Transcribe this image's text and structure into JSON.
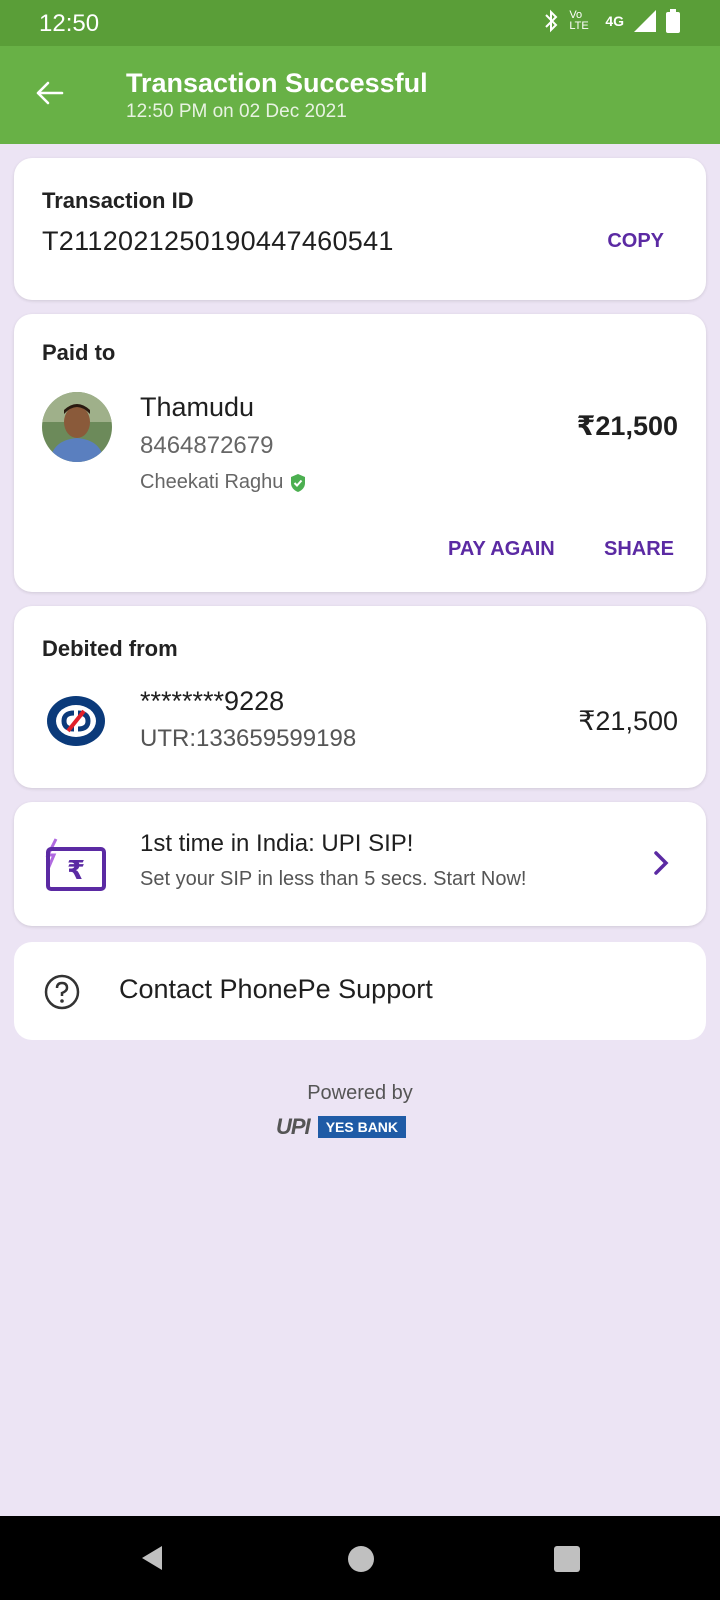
{
  "status_bar": {
    "time": "12:50",
    "network": "4G",
    "volte": "Vo LTE"
  },
  "header": {
    "title": "Transaction Successful",
    "subtitle": "12:50 PM on 02 Dec 2021"
  },
  "transaction": {
    "label": "Transaction ID",
    "id": "T2112021250190447460541",
    "copy_label": "COPY"
  },
  "paid_to": {
    "label": "Paid to",
    "name": "Thamudu",
    "phone": "8464872679",
    "verified_name": "Cheekati Raghu",
    "amount": "₹21,500",
    "pay_again_label": "PAY AGAIN",
    "share_label": "SHARE"
  },
  "debited_from": {
    "label": "Debited from",
    "account": "********9228",
    "utr": "UTR:133659599198",
    "amount": "₹21,500"
  },
  "promo": {
    "title": "1st time in India: UPI SIP!",
    "subtitle": "Set your SIP in less than 5 secs. Start Now!"
  },
  "support": {
    "label": "Contact PhonePe Support"
  },
  "footer": {
    "powered_by": "Powered by",
    "upi_logo": "UPI",
    "bank_logo": "YES BANK"
  },
  "colors": {
    "status_bar": "#5a9e38",
    "app_bar": "#68b146",
    "accent": "#5b2aa3",
    "background": "#ece4f4"
  }
}
